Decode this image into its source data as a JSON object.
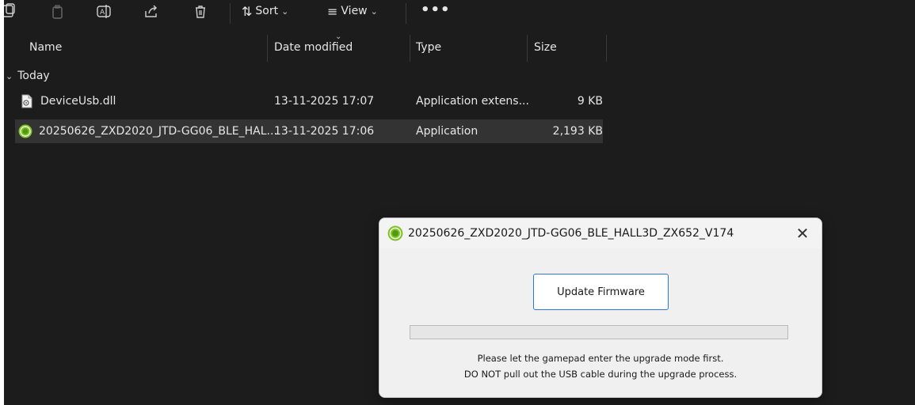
{
  "toolbar": {
    "icons": [
      "new-icon",
      "copy-icon",
      "rename-icon",
      "share-icon",
      "delete-icon",
      "sort-arrows-icon",
      "view-lines-icon"
    ],
    "sort_label": "Sort",
    "view_label": "View",
    "more_label": "•••"
  },
  "columns": {
    "name": "Name",
    "date_modified": "Date modified",
    "type": "Type",
    "size": "Size"
  },
  "group": {
    "label": "Today"
  },
  "files": [
    {
      "name": "DeviceUsb.dll",
      "date": "13-11-2025 17:07",
      "type": "Application extens...",
      "size": "9 KB",
      "icon": "dll-file-icon",
      "selected": false
    },
    {
      "name": "20250626_ZXD2020_JTD-GG06_BLE_HAL...",
      "date": "13-11-2025 17:06",
      "type": "Application",
      "size": "2,193 KB",
      "icon": "green-app-icon",
      "selected": true
    }
  ],
  "dialog": {
    "title": "20250626_ZXD2020_JTD-GG06_BLE_HALL3D_ZX652_V174",
    "close_label": "✕",
    "update_button": "Update Firmware",
    "progress": 0,
    "message_line1": "Please let the gamepad enter the upgrade mode first.",
    "message_line2": "DO NOT pull out the USB cable during the upgrade process.",
    "accent_color": "#2c7ad6",
    "progress_color": "#06b025"
  }
}
